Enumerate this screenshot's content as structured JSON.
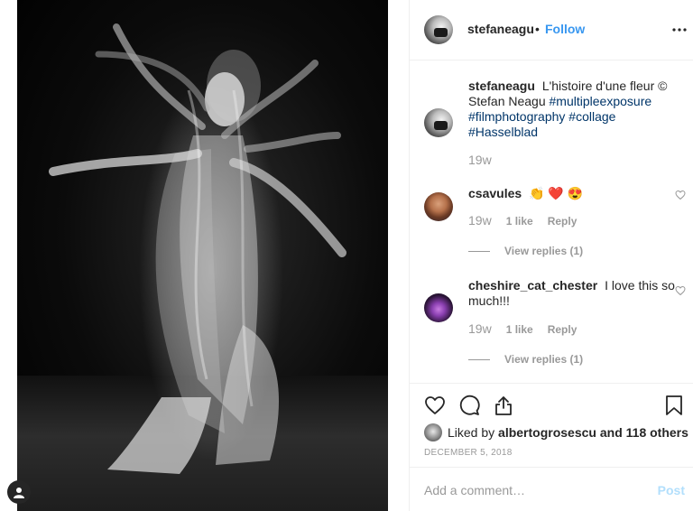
{
  "post": {
    "username": "stefaneagu",
    "follow_label": "Follow",
    "separator": "•",
    "more_label": "•••"
  },
  "caption": {
    "username": "stefaneagu",
    "text": "L'histoire d'une fleur © Stefan Neagu",
    "hashtags": [
      "#multipleexposure",
      "#filmphotography",
      "#collage",
      "#Hasselblad"
    ],
    "time": "19w"
  },
  "comments": [
    {
      "username": "csavules",
      "text": "👏 ❤️ 😍",
      "time": "19w",
      "likes": "1 like",
      "reply_label": "Reply",
      "view_replies": "View replies (1)"
    },
    {
      "username": "cheshire_cat_chester",
      "text": "I love this so much!!!",
      "time": "19w",
      "likes": "1 like",
      "reply_label": "Reply",
      "view_replies": "View replies (1)"
    }
  ],
  "likes": {
    "prefix": "Liked by",
    "user": "albertogrosescu",
    "suffix": "and 118 others"
  },
  "date": "DECEMBER 5, 2018",
  "add_comment": {
    "placeholder": "Add a comment…",
    "post_label": "Post"
  },
  "icons": {
    "like": "heart-icon",
    "comment": "comment-icon",
    "share": "share-icon",
    "save": "bookmark-icon",
    "tag": "user-tag-icon"
  },
  "colors": {
    "link": "#3897f0",
    "hashtag": "#003569",
    "muted": "#999999",
    "post_disabled": "#b2dffc"
  }
}
